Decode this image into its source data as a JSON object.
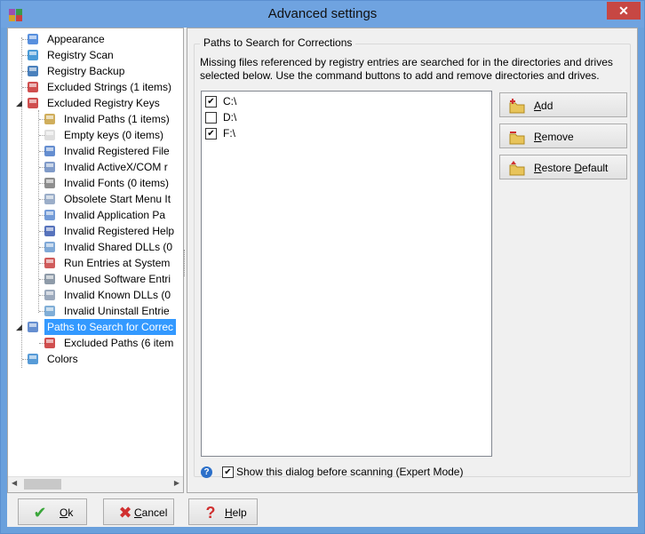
{
  "window": {
    "title": "Advanced settings",
    "close_glyph": "✕"
  },
  "tree": {
    "items": [
      {
        "label": "Appearance",
        "icon": "monitor-icon"
      },
      {
        "label": "Registry Scan",
        "icon": "registry-scan-icon"
      },
      {
        "label": "Registry Backup",
        "icon": "backup-icon"
      },
      {
        "label": "Excluded Strings (1 items)",
        "icon": "excluded-strings-icon"
      },
      {
        "label": "Excluded Registry Keys",
        "icon": "excluded-keys-icon"
      },
      {
        "label": "Invalid Paths (1 items)",
        "icon": "invalid-paths-icon"
      },
      {
        "label": "Empty keys (0 items)",
        "icon": "empty-keys-icon"
      },
      {
        "label": "Invalid Registered File",
        "icon": "registered-file-icon"
      },
      {
        "label": "Invalid ActiveX/COM r",
        "icon": "activex-icon"
      },
      {
        "label": "Invalid Fonts (0 items)",
        "icon": "fonts-icon"
      },
      {
        "label": "Obsolete Start Menu It",
        "icon": "start-menu-icon"
      },
      {
        "label": "Invalid Application Pa",
        "icon": "application-path-icon"
      },
      {
        "label": "Invalid Registered Help",
        "icon": "help-file-icon"
      },
      {
        "label": "Invalid Shared DLLs (0",
        "icon": "shared-dll-icon"
      },
      {
        "label": "Run Entries at System",
        "icon": "run-entries-icon"
      },
      {
        "label": "Unused Software Entri",
        "icon": "software-icon"
      },
      {
        "label": "Invalid Known DLLs (0",
        "icon": "known-dll-icon"
      },
      {
        "label": "Invalid Uninstall Entrie",
        "icon": "uninstall-icon"
      },
      {
        "label": "Paths to Search for Correc",
        "icon": "search-paths-icon"
      },
      {
        "label": "Excluded Paths (6 item",
        "icon": "excluded-paths-icon"
      },
      {
        "label": "Colors",
        "icon": "palette-icon"
      }
    ],
    "selected_index": 18
  },
  "panel": {
    "group_title": "Paths to Search for Corrections",
    "description": "Missing files referenced by registry entries are searched for in the directories and drives selected below. Use the command buttons to add and remove directories and drives.",
    "drives": [
      {
        "label": "C:\\",
        "checked": true
      },
      {
        "label": "D:\\",
        "checked": false
      },
      {
        "label": "F:\\",
        "checked": true
      }
    ],
    "buttons": {
      "add_mn": "A",
      "add": "dd",
      "remove_mn": "R",
      "remove": "emove",
      "restore_mn": "R",
      "restore": "estore ",
      "restore_mn2": "D",
      "restore2": "efault"
    },
    "expert": {
      "label": "Show this dialog before scanning (Expert Mode)",
      "checked": true
    }
  },
  "footer": {
    "ok_mn": "O",
    "ok": "k",
    "cancel_mn": "C",
    "cancel": "ancel",
    "help_mn": "H",
    "help": "elp"
  },
  "colors": {
    "titlebar": "#6fa3e0",
    "selection": "#3399ff",
    "close": "#c74743"
  }
}
